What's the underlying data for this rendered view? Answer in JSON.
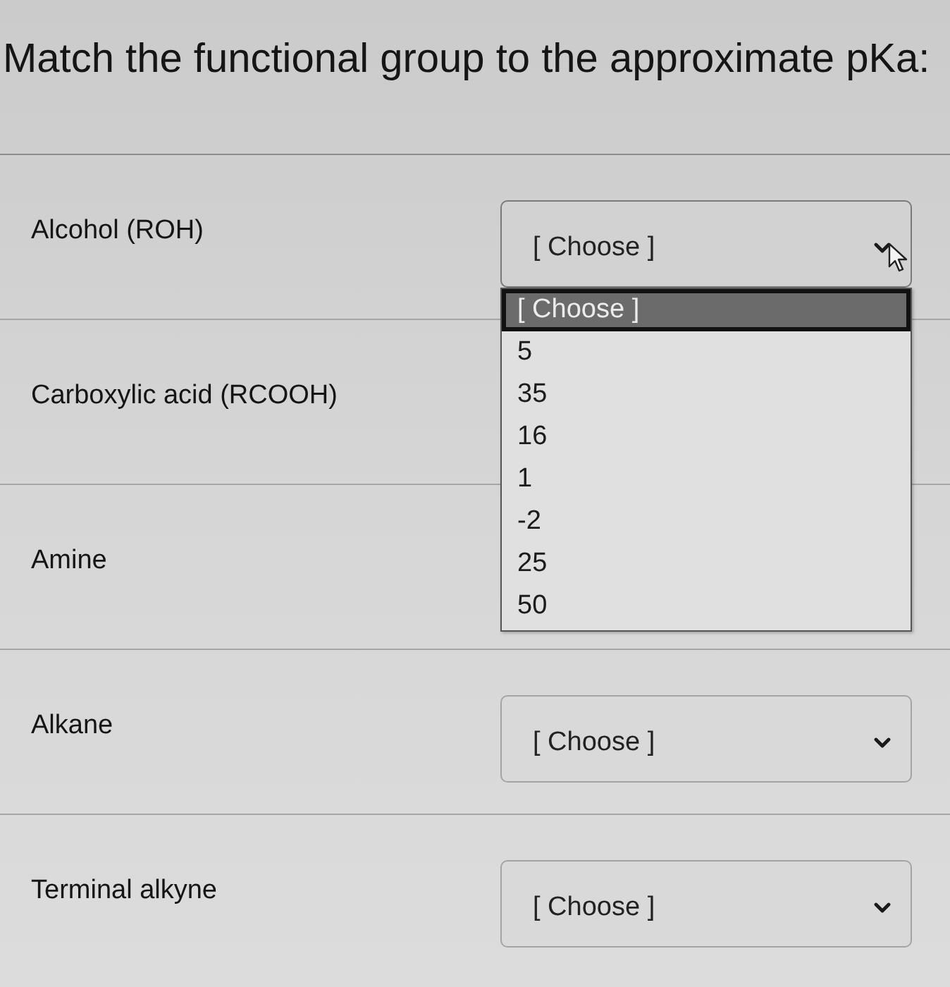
{
  "title": "Match the functional group to the approximate pKa:",
  "rows": [
    {
      "label": "Alcohol (ROH)",
      "value": "[ Choose ]",
      "open": true,
      "options": [
        {
          "label": "[ Choose ]",
          "selected": true
        },
        {
          "label": "5",
          "selected": false
        },
        {
          "label": "35",
          "selected": false
        },
        {
          "label": "16",
          "selected": false
        },
        {
          "label": "1",
          "selected": false
        },
        {
          "label": "-2",
          "selected": false
        },
        {
          "label": "25",
          "selected": false
        },
        {
          "label": "50",
          "selected": false
        }
      ]
    },
    {
      "label": "Carboxylic acid (RCOOH)"
    },
    {
      "label": "Amine"
    },
    {
      "label": "Alkane",
      "value": "[ Choose ]",
      "open": false
    },
    {
      "label": "Terminal alkyne",
      "value": "[ Choose ]",
      "open": false
    }
  ]
}
